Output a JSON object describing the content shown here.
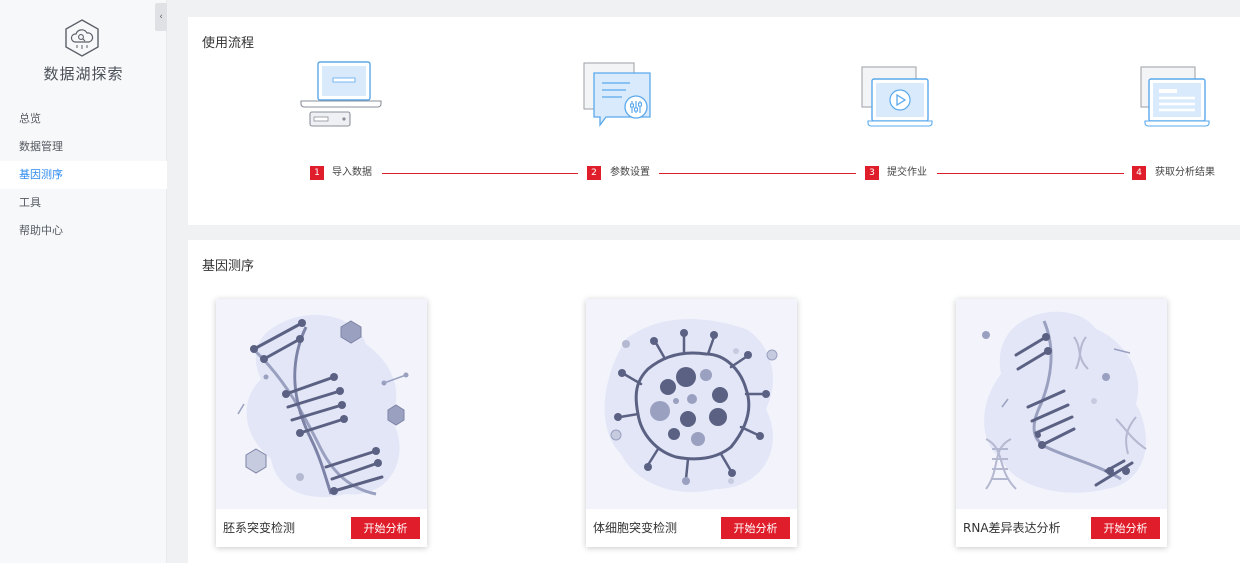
{
  "app": {
    "title": "数据湖探索",
    "logo_icon": "cloud-search-icon"
  },
  "sidebar": {
    "collapse_icon": "chevron-left-icon",
    "collapse_glyph": "‹",
    "items": [
      {
        "label": "总览",
        "active": false
      },
      {
        "label": "数据管理",
        "active": false
      },
      {
        "label": "基因测序",
        "active": true
      },
      {
        "label": "工具",
        "active": false
      },
      {
        "label": "帮助中心",
        "active": false
      }
    ]
  },
  "flow": {
    "title": "使用流程",
    "steps": [
      {
        "num": "1",
        "label": "导入数据",
        "icon": "laptop-server-icon"
      },
      {
        "num": "2",
        "label": "参数设置",
        "icon": "settings-document-icon"
      },
      {
        "num": "3",
        "label": "提交作业",
        "icon": "laptop-play-icon"
      },
      {
        "num": "4",
        "label": "获取分析结果",
        "icon": "laptop-report-icon"
      }
    ]
  },
  "genes": {
    "title": "基因测序",
    "cards": [
      {
        "title": "胚系突变检测",
        "button": "开始分析",
        "icon": "dna-icon"
      },
      {
        "title": "体细胞突变检测",
        "button": "开始分析",
        "icon": "cell-icon"
      },
      {
        "title": "RNA差异表达分析",
        "button": "开始分析",
        "icon": "rna-icon"
      }
    ]
  },
  "colors": {
    "accent": "#e01e2b",
    "nav_active": "#2e8cf0",
    "illus_blue": "#5aa9ec",
    "illus_navy": "#5b6183"
  }
}
